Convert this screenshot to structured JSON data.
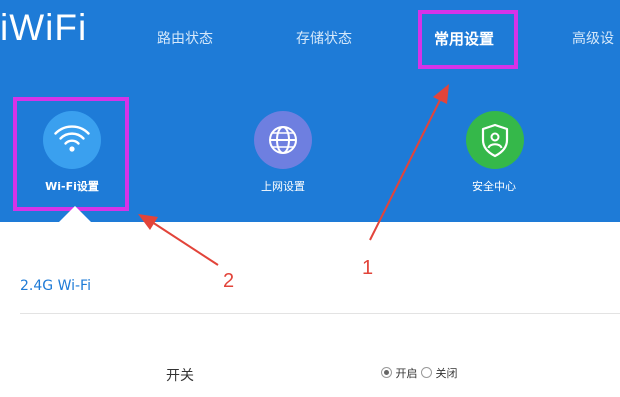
{
  "app": {
    "logo": "iWiFi"
  },
  "nav": {
    "items": [
      {
        "label": "路由状态"
      },
      {
        "label": "存储状态"
      },
      {
        "label": "常用设置",
        "active": true
      },
      {
        "label": "高级设"
      }
    ]
  },
  "tiles": [
    {
      "label": "Wi-Fi设置",
      "icon": "wifi-icon",
      "color": "#3aa0ef",
      "active": true
    },
    {
      "label": "上网设置",
      "icon": "globe-icon",
      "color": "#6e7fe0"
    },
    {
      "label": "安全中心",
      "icon": "shield-icon",
      "color": "#35b84a"
    }
  ],
  "section": {
    "title": "2.4G Wi-Fi"
  },
  "form": {
    "switch_label": "开关",
    "options": [
      {
        "label": "开启",
        "checked": true
      },
      {
        "label": "关闭",
        "checked": false
      }
    ]
  },
  "annotations": {
    "one": "1",
    "two": "2",
    "color": "#e2443a",
    "highlight_color": "#d633e8"
  },
  "colors": {
    "header_bg": "#1e7bd7",
    "accent": "#1e7bd7"
  }
}
